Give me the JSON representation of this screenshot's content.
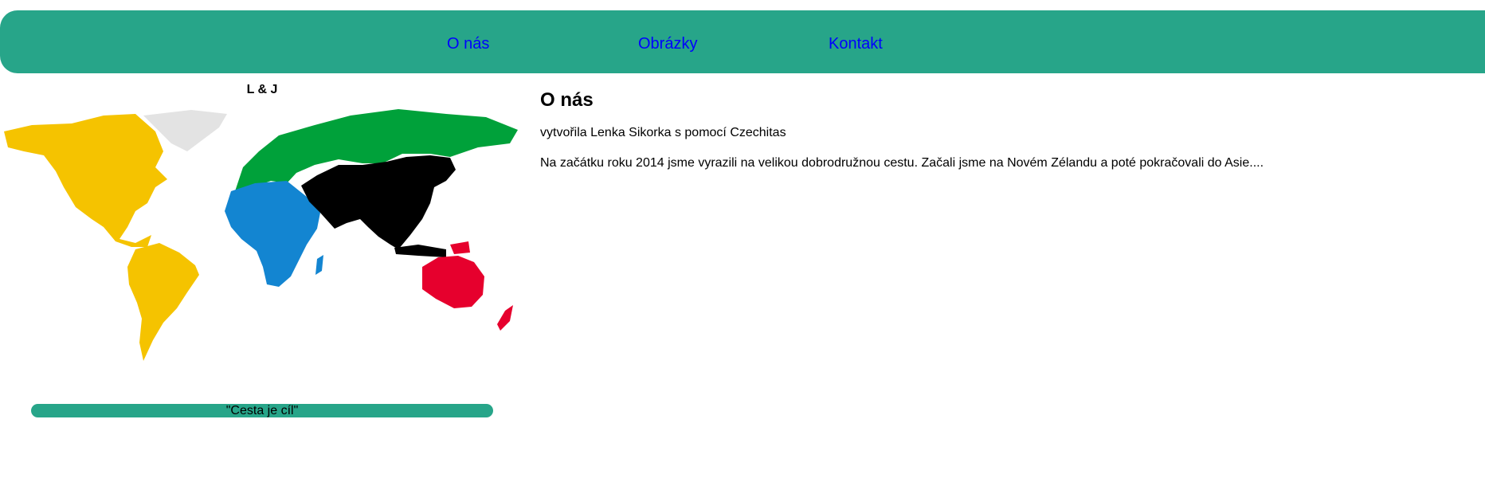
{
  "nav": {
    "items": [
      {
        "label": "O nás"
      },
      {
        "label": "Obrázky"
      },
      {
        "label": "Kontakt"
      }
    ]
  },
  "sidebar": {
    "title": "L & J",
    "motto": "\"Cesta je cíl\""
  },
  "content": {
    "heading": "O nás",
    "author_line": "vytvořila Lenka Sikorka s pomocí Czechitas",
    "intro": "Na začátku roku 2014 jsme vyrazili na velikou dobrodružnou cestu. Začali jsme na Novém Zélandu a poté pokračovali do Asie...."
  },
  "map": {
    "icon": "world-map-continents",
    "colors": {
      "americas": "#f5c300",
      "greenland": "#e3e3e3",
      "europe_north_asia": "#00a13a",
      "africa": "#1385d1",
      "asia": "#000000",
      "oceania": "#e6002d"
    }
  },
  "colors": {
    "accent": "#27a589",
    "link": "#0000ff"
  }
}
